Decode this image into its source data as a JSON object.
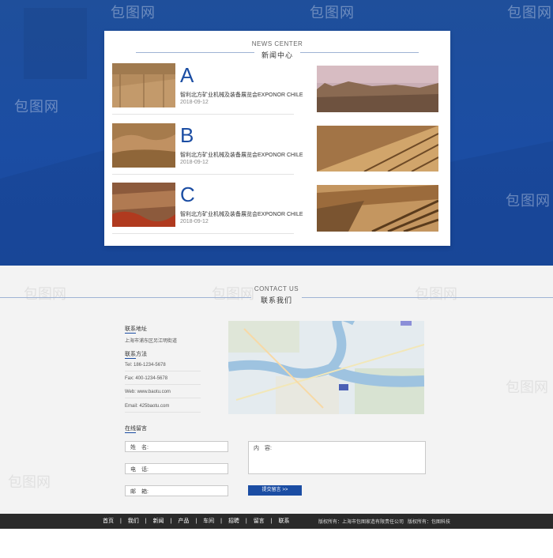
{
  "watermark": "包图网",
  "news": {
    "en_title": "NEWS CENTER",
    "cn_title": "新闻中心",
    "items": [
      {
        "letter": "A",
        "title": "智利北方矿业机械及装备展览会EXPONOR CHILE",
        "date": "2018-09-12"
      },
      {
        "letter": "B",
        "title": "智利北方矿业机械及装备展览会EXPONOR CHILE",
        "date": "2018-09-12"
      },
      {
        "letter": "C",
        "title": "智利北方矿业机械及装备展览会EXPONOR CHILE",
        "date": "2018-09-12"
      }
    ]
  },
  "contact": {
    "en_title": "CONTACT US",
    "cn_title": "联系我们",
    "address_label": "联系地址",
    "address_value": "上海市浦东区另江明街道",
    "method_label": "联系方法",
    "tel": "Tel: 186-1234-5678",
    "fax": "Fax: 400-1234-5678",
    "web": "Web: www.baotu.com",
    "email": "Email: 425baotu.com",
    "message_label": "在线留言",
    "name_field": "姓　名:",
    "phone_field": "电　话:",
    "mail_field": "邮　箱:",
    "content_field": "内　容:",
    "submit": "提交留言 >>"
  },
  "footer": {
    "nav": [
      "首页",
      "我们",
      "新闻",
      "产品",
      "车间",
      "招聘",
      "留言",
      "联系"
    ],
    "copyright1": "版权所有：上海市包图家造有限责任公司",
    "copyright2": "版权所有：包图科技"
  },
  "colors": {
    "primary": "#1b4da3",
    "footer": "#2a2a2a",
    "contact_bg": "#f3f3f3"
  }
}
